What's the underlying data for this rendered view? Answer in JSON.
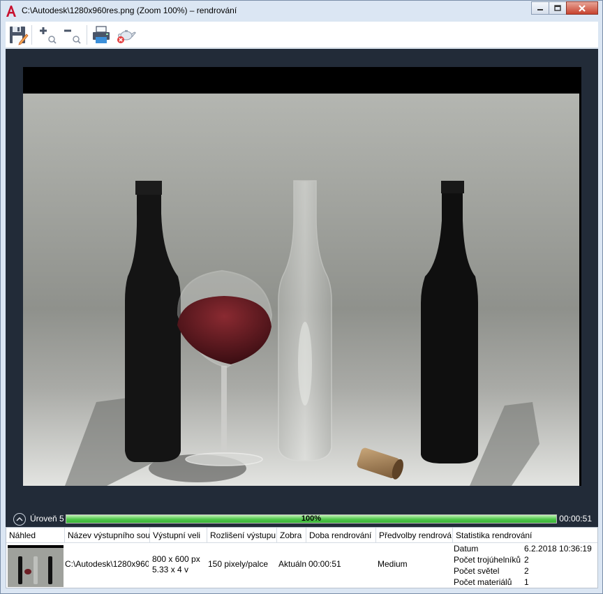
{
  "window": {
    "title": "C:\\Autodesk\\1280x960res.png (Zoom 100%) – rendrování"
  },
  "icons": {
    "app": "autocad-logo-icon",
    "minimize": "minimize-icon",
    "maximize": "maximize-icon",
    "close": "close-icon",
    "save": "save-icon",
    "zoom_in": "zoom-in-icon",
    "zoom_out": "zoom-out-icon",
    "print": "print-icon",
    "cancel_render": "teapot-cancel-icon",
    "collapse": "chevron-up-icon"
  },
  "colors": {
    "render_bg": "#222b38",
    "progress": "#4fc64a",
    "close_button": "#c7432f"
  },
  "progress": {
    "level_label": "Úroveň 5",
    "fraction": 1.0,
    "percent_text": "100%",
    "elapsed": "00:00:51"
  },
  "table": {
    "headers": [
      "Náhled",
      "Název výstupního sou",
      "Výstupní veli",
      "Rozlišení výstupu",
      "Zobra",
      "Doba rendrování",
      "Předvolby rendrová",
      "Statistika rendrování"
    ],
    "row": {
      "output_name": "C:\\Autodesk\\1280x960",
      "output_size_px": "800 x 600 px",
      "output_size_in": "5.33 x 4 v",
      "resolution": "150 pixely/palce",
      "view": "Aktuáln",
      "render_time": "00:00:51",
      "preset": "Medium",
      "stats": [
        {
          "label": "Datum",
          "value": "6.2.2018 10:36:19"
        },
        {
          "label": "Počet trojúhelníků",
          "value": "2"
        },
        {
          "label": "Počet světel",
          "value": "2"
        },
        {
          "label": "Počet materiálů",
          "value": "1"
        }
      ]
    }
  }
}
